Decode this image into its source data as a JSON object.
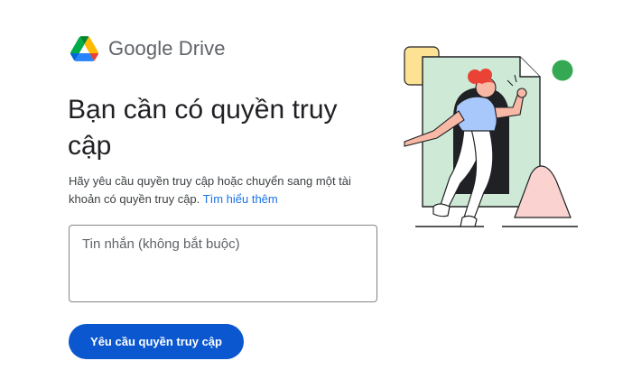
{
  "brand": {
    "logo_icon": "google-drive-logo-icon",
    "name": "Google Drive"
  },
  "main": {
    "title": "Bạn cần có quyền truy cập",
    "description": "Hãy yêu cầu quyền truy cập hoặc chuyển sang một tài khoản có quyền truy cập.",
    "learn_more_link": "Tìm hiểu thêm",
    "message_placeholder": "Tin nhắn (không bắt buộc)",
    "message_value": "",
    "request_button_label": "Yêu cầu quyền truy cập"
  },
  "colors": {
    "primary_button": "#0b57d0",
    "link": "#1a73e8",
    "brand_text": "#5f6368",
    "illustration_green": "#34a853",
    "illustration_red": "#ea4335"
  }
}
